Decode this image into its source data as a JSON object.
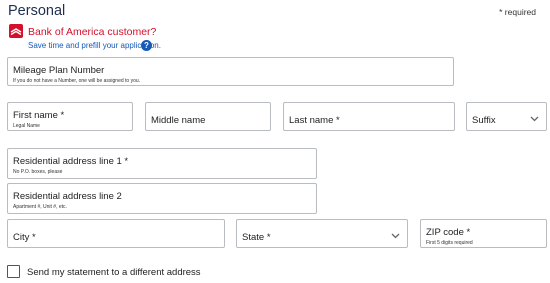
{
  "section": {
    "title": "Personal",
    "required_note": "* required"
  },
  "boa": {
    "question": "Bank of America customer?",
    "prefill_link": "Save time and prefill your application.",
    "help_glyph": "?",
    "brand_color": "#d4102c",
    "link_color": "#1659b8"
  },
  "fields": {
    "mileage": {
      "label": "Mileage Plan Number",
      "hint": "If you do not have a Number, one will be assigned to you."
    },
    "first_name": {
      "label": "First name *",
      "hint": "Legal Name"
    },
    "middle_name": {
      "label": "Middle name"
    },
    "last_name": {
      "label": "Last name *"
    },
    "suffix": {
      "label": "Suffix"
    },
    "address1": {
      "label": "Residential address line 1 *",
      "hint": "No P.O. boxes, please"
    },
    "address2": {
      "label": "Residential address line 2",
      "hint": "Apartment #, Unit #, etc."
    },
    "city": {
      "label": "City *"
    },
    "state": {
      "label": "State *"
    },
    "zip": {
      "label": "ZIP code *",
      "hint": "First 5 digits required"
    }
  },
  "statement_checkbox": {
    "label": "Send my statement to a different address",
    "checked": false
  }
}
